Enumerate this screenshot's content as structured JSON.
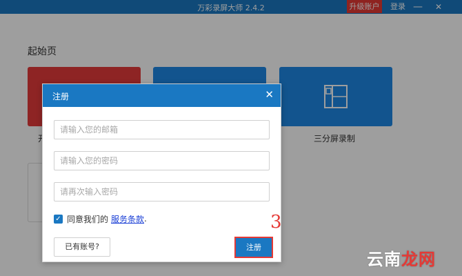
{
  "app": {
    "window_title": "万彩录屏大师 2.4.2",
    "upgrade_label": "升级账户",
    "login_label": "登录",
    "minimize_glyph": "—",
    "close_glyph": "✕"
  },
  "home": {
    "heading": "起始页",
    "cards": [
      {
        "label": "开",
        "color": "#e53a3a"
      },
      {
        "label": "",
        "color": "#1e88e5"
      },
      {
        "label": "三分屏录制",
        "color": "#1e88e5",
        "icon": "split-screen-icon"
      }
    ]
  },
  "dialog": {
    "title": "注册",
    "close_glyph": "✕",
    "email_placeholder": "请输入您的邮箱",
    "password_placeholder": "请输入您的密码",
    "password_confirm_placeholder": "请再次输入密码",
    "agree_text": "同意我们的",
    "terms_link": "服务条款",
    "terms_period": ".",
    "agree_checked": true,
    "have_account_label": "已有账号?",
    "register_label": "注册"
  },
  "annotation": {
    "step_number": "3",
    "highlight_color": "#e53935"
  },
  "watermark": {
    "part1": "云南",
    "part2": "龙网"
  }
}
